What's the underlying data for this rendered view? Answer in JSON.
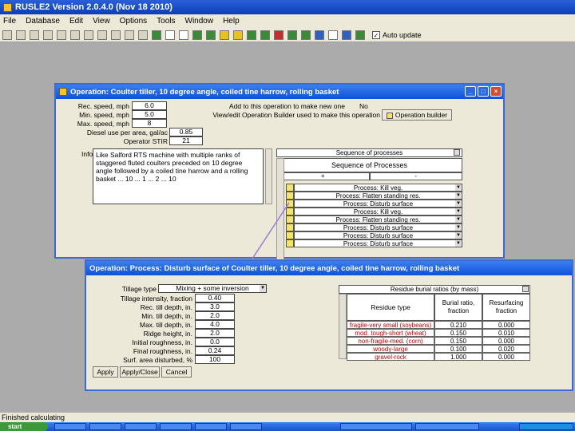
{
  "app": {
    "title": "RUSLE2 Version 2.0.4.0 (Nov 18 2010)"
  },
  "menu": [
    "File",
    "Database",
    "Edit",
    "View",
    "Options",
    "Tools",
    "Window",
    "Help"
  ],
  "toolbar": {
    "auto_update": "Auto update",
    "auto_update_checked": true
  },
  "op_window": {
    "title": "Operation: Coulter tiller, 10 degree angle, coiled tine harrow, rolling basket",
    "fields": [
      {
        "label": "Rec. speed, mph",
        "value": "6.0"
      },
      {
        "label": "Min. speed, mph",
        "value": "5.0"
      },
      {
        "label": "Max. speed, mph",
        "value": "8"
      },
      {
        "label": "Diesel use per area, gal/ac",
        "value": "0.85"
      },
      {
        "label": "Operator STIR",
        "value": "21"
      }
    ],
    "add_label_1": "Add to this operation to make new one",
    "add_value": "No",
    "add_label_2": "View/edit Operation Builder used to make this operation",
    "builder_label": "Operation builder",
    "info_label": "Info",
    "info_text": "Like Salford RTS machine with multiple ranks of staggered fluted coulters preceded on 10 degree angle followed by a coiled tine harrow and a rolling basket ... 10 ... 1 ... 2 ... 10",
    "seq_header": "Sequence of processes",
    "seq_title": "Sequence of Processes",
    "seq_cols": [
      "+",
      "-"
    ],
    "processes": [
      "Process: Kill veg.",
      "Process: Flatten standing res.",
      "Process: Disturb surface",
      "Process: Kill veg.",
      "Process: Flatten standing res.",
      "Process: Disturb surface",
      "Process: Disturb surface",
      "Process: Disturb surface"
    ]
  },
  "proc_window": {
    "title": "Operation: Process: Disturb surface of Coulter tiller, 10 degree angle, coiled tine harrow, rolling basket",
    "tillage_type_label": "Tillage type",
    "tillage_type_value": "Mixing + some inversion",
    "fields": [
      {
        "label": "Tillage intensity, fraction",
        "value": "0.40"
      },
      {
        "label": "Rec. till depth, in.",
        "value": "3.0"
      },
      {
        "label": "Min. till depth, in.",
        "value": "2.0"
      },
      {
        "label": "Max. till depth, in.",
        "value": "4.0"
      },
      {
        "label": "Ridge height, in.",
        "value": "2.0"
      },
      {
        "label": "Initial roughness, in.",
        "value": "0.0"
      },
      {
        "label": "Final roughness, in.",
        "value": "0.24"
      },
      {
        "label": "Surf. area disturbed, %",
        "value": "100"
      }
    ],
    "buttons": [
      "Apply",
      "Apply/Close",
      "Cancel"
    ],
    "residue_header": "Residue burial ratios (by mass)",
    "residue_cols": [
      "Residue type",
      "Burial ratio, fraction",
      "Resurfacing fraction"
    ],
    "residue_rows": [
      {
        "type": "fragile-very small (soybeans)",
        "burial": "0.210",
        "resurf": "0.000"
      },
      {
        "type": "mod. tough-short (wheat)",
        "burial": "0.150",
        "resurf": "0.010"
      },
      {
        "type": "non-fragile-med. (corn)",
        "burial": "0.150",
        "resurf": "0.000"
      },
      {
        "type": "woody-large",
        "burial": "0.100",
        "resurf": "0.020"
      },
      {
        "type": "gravel-rock",
        "burial": "1.000",
        "resurf": "0.000"
      }
    ]
  },
  "status": {
    "text": "Finished calculating"
  },
  "taskbar": {
    "start": "start"
  }
}
